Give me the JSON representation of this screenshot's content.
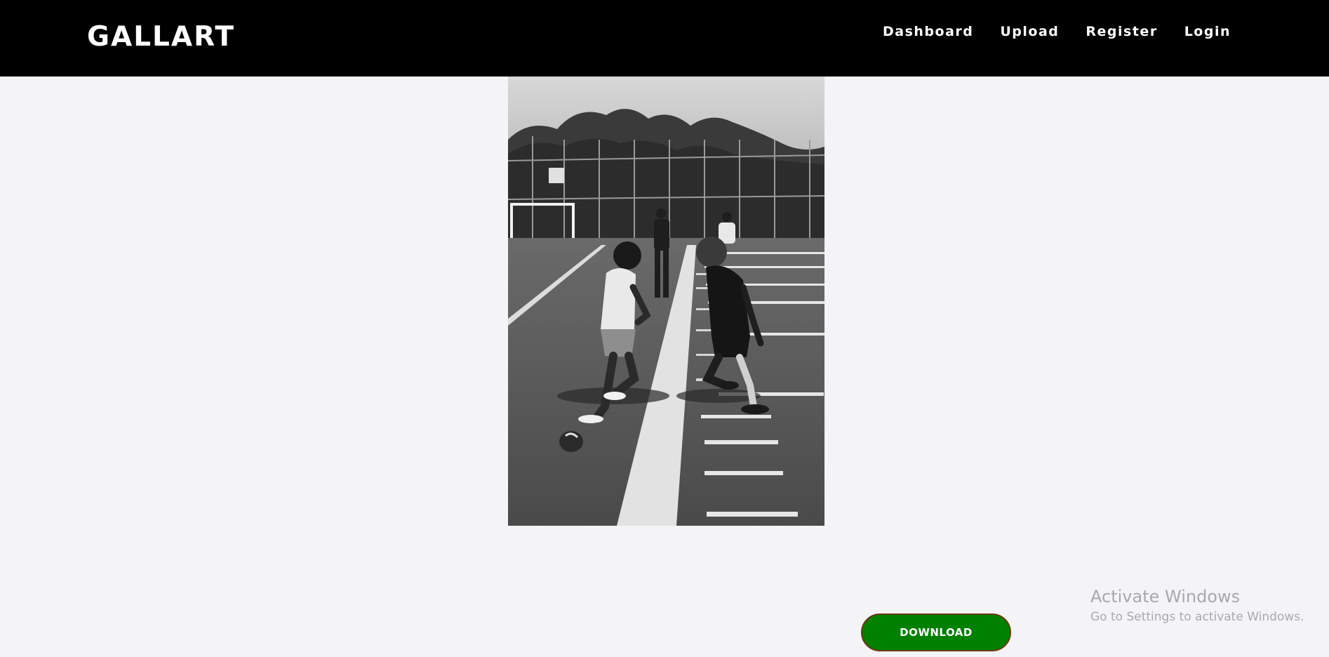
{
  "header": {
    "brand": "GALLART",
    "nav": [
      {
        "label": "Dashboard"
      },
      {
        "label": "Upload"
      },
      {
        "label": "Register"
      },
      {
        "label": "Login"
      }
    ]
  },
  "main": {
    "image_alt": "Black and white photo of two football players facing off on a field",
    "download_label": "DOWNLOAD"
  },
  "os_watermark": {
    "title": "Activate Windows",
    "subtitle": "Go to Settings to activate Windows."
  },
  "colors": {
    "navbar": "#000000",
    "page_background": "#f4f4f6",
    "download_button": "#008000"
  }
}
